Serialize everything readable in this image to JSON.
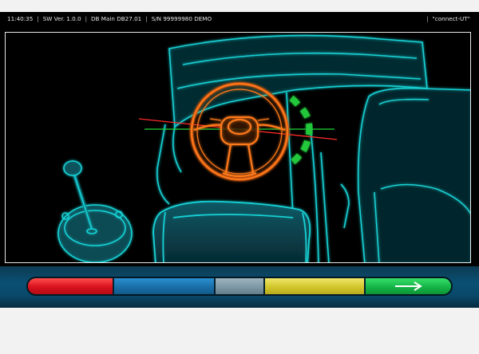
{
  "statusbar": {
    "time": "11:40:35",
    "sw_version": "SW Ver. 1.0.0",
    "db_version": "DB Main DB27.01",
    "serial": "S/N 99999980 DEMO",
    "connection": "\"connect-UT\""
  },
  "toolbar": {
    "buttons": [
      {
        "color": "#d8121e",
        "icon": ""
      },
      {
        "color": "#1a6fa8",
        "icon": ""
      },
      {
        "color": "#7d97a4",
        "icon": ""
      },
      {
        "color": "#d2c52c",
        "icon": ""
      },
      {
        "color": "#15b447",
        "icon": "arrow-right-icon"
      }
    ]
  },
  "scene": {
    "wireframe_color": "#19d2d6",
    "steering_wheel_color": "#ff7a1a",
    "reference_line_red": "#ff2a2a",
    "reference_line_green": "#22d83a",
    "indicator_color": "#22c73a"
  }
}
